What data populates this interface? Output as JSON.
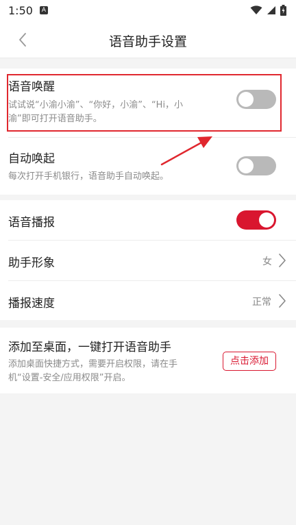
{
  "status_bar": {
    "time": "1:50",
    "badge": "A",
    "icons": [
      "wifi-icon",
      "signal-icon",
      "battery-icon"
    ]
  },
  "header": {
    "back_icon": "chevron-left-icon",
    "title": "语音助手设置"
  },
  "settings": {
    "voice_wakeup": {
      "title": "语音唤醒",
      "desc_line1": "试试说“小渝小渝”、“你好，小渝”、“Hi，小",
      "desc_line2": "渝”即可打开语音助手。",
      "enabled": false
    },
    "auto_wakeup": {
      "title": "自动唤起",
      "desc": "每次打开手机银行，语音助手自动唤起。",
      "enabled": false
    },
    "voice_broadcast": {
      "title": "语音播报",
      "enabled": true
    },
    "assistant_image": {
      "title": "助手形象",
      "value": "女"
    },
    "broadcast_speed": {
      "title": "播报速度",
      "value": "正常"
    },
    "add_to_desktop": {
      "title": "添加至桌面，一键打开语音助手",
      "desc_line1": "添加桌面快捷方式，需要开启权限，请在手",
      "desc_line2": "机“设置-安全/应用权限”开启。",
      "button_label": "点击添加"
    }
  },
  "colors": {
    "accent": "#d9162f",
    "toggle_off": "#b9b9b9",
    "annotation": "#e0272e"
  }
}
